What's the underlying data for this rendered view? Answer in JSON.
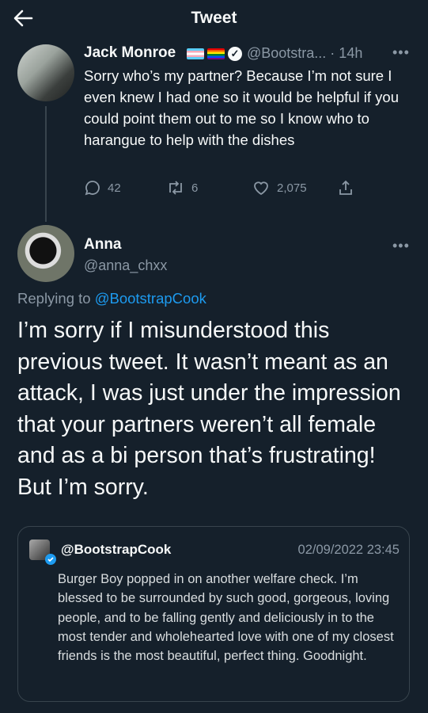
{
  "header": {
    "back_icon": "arrow-left-icon",
    "title": "Tweet"
  },
  "parent_tweet": {
    "author_name": "Jack Monroe",
    "handle_time": "@Bootstra... · 14h",
    "text": "Sorry who’s my partner? Because I’m not sure I even knew I had one so it would be helpful if you could point them out to me so I know who to harangue to help with the dishes",
    "replies": "42",
    "retweets": "6",
    "likes": "2,075"
  },
  "main_tweet": {
    "author_name": "Anna",
    "handle": "@anna_chxx",
    "replying_prefix": "Replying to",
    "replying_to": "@BootstrapCook",
    "text": "I’m sorry if I misunderstood this previous tweet. It wasn’t meant as an attack, I was just under the impression that your partners weren’t all female and as a bi person that’s frustrating! But I’m sorry."
  },
  "quoted_tweet": {
    "handle": "@BootstrapCook",
    "date": "02/09/2022 23:45",
    "text": "Burger Boy popped in on another welfare check. I’m blessed to be surrounded by such good, gorgeous, loving people, and to be falling gently and deliciously in to the most tender and wholehearted love with one of my closest friends is the most beautiful, perfect thing. Goodnight."
  },
  "colors": {
    "background": "#15202b",
    "text": "#f7f9f9",
    "muted": "#8b98a5",
    "link": "#1d9bf0",
    "border": "#38444d"
  }
}
